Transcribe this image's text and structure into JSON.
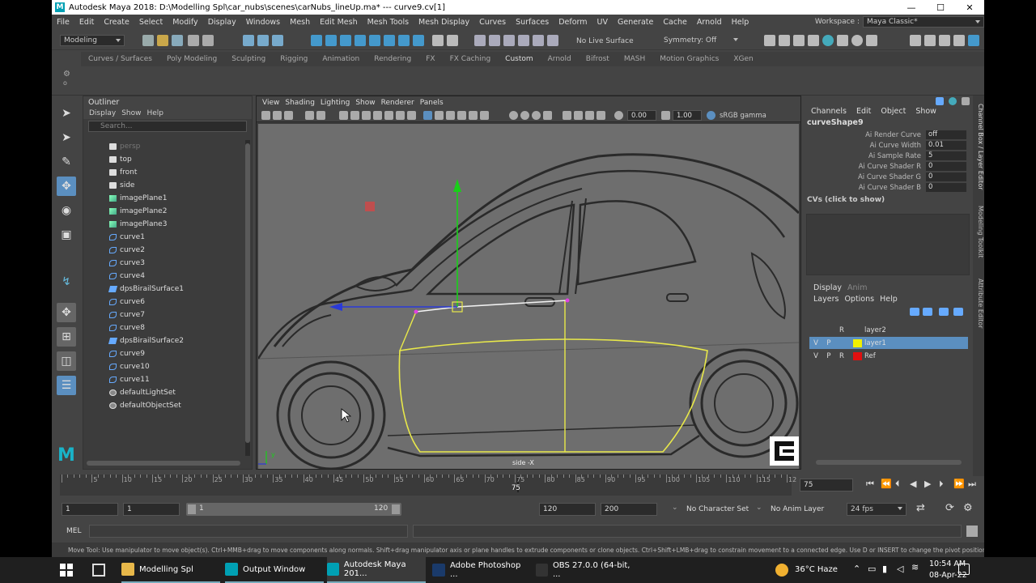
{
  "window": {
    "title": "Autodesk Maya 2018: D:\\Modelling Spl\\car_nubs\\scenes\\carNubs_lineUp.ma*  ---  curve9.cv[1]",
    "logo_letter": "M",
    "minimize": "—",
    "maximize": "☐",
    "close": "✕"
  },
  "menubar": [
    "File",
    "Edit",
    "Create",
    "Select",
    "Modify",
    "Display",
    "Windows",
    "Mesh",
    "Edit Mesh",
    "Mesh Tools",
    "Mesh Display",
    "Curves",
    "Surfaces",
    "Deform",
    "UV",
    "Generate",
    "Cache",
    "Arnold",
    "Help"
  ],
  "workspace": {
    "label": "Workspace :",
    "value": "Maya Classic*"
  },
  "statusline": {
    "mode": "Modeling",
    "live_surface": "No Live Surface",
    "symmetry": "Symmetry: Off"
  },
  "shelf_tabs": [
    "Curves / Surfaces",
    "Poly Modeling",
    "Sculpting",
    "Rigging",
    "Animation",
    "Rendering",
    "FX",
    "FX Caching",
    "Custom",
    "Arnold",
    "Bifrost",
    "MASH",
    "Motion Graphics",
    "XGen"
  ],
  "shelf_active": "Custom",
  "outliner": {
    "title": "Outliner",
    "menu": [
      "Display",
      "Show",
      "Help"
    ],
    "search_placeholder": "Search...",
    "items": [
      {
        "label": "persp",
        "type": "cam",
        "dim": true
      },
      {
        "label": "top",
        "type": "cam"
      },
      {
        "label": "front",
        "type": "cam"
      },
      {
        "label": "side",
        "type": "cam"
      },
      {
        "label": "imagePlane1",
        "type": "img"
      },
      {
        "label": "imagePlane2",
        "type": "img"
      },
      {
        "label": "imagePlane3",
        "type": "img"
      },
      {
        "label": "curve1",
        "type": "crv"
      },
      {
        "label": "curve2",
        "type": "crv"
      },
      {
        "label": "curve3",
        "type": "crv"
      },
      {
        "label": "curve4",
        "type": "crv"
      },
      {
        "label": "dpsBirailSurface1",
        "type": "srf"
      },
      {
        "label": "curve6",
        "type": "crv"
      },
      {
        "label": "curve7",
        "type": "crv"
      },
      {
        "label": "curve8",
        "type": "crv"
      },
      {
        "label": "dpsBirailSurface2",
        "type": "srf"
      },
      {
        "label": "curve9",
        "type": "crv"
      },
      {
        "label": "curve10",
        "type": "crv"
      },
      {
        "label": "curve11",
        "type": "crv"
      },
      {
        "label": "defaultLightSet",
        "type": "set"
      },
      {
        "label": "defaultObjectSet",
        "type": "set"
      }
    ]
  },
  "viewport": {
    "menu": [
      "View",
      "Shading",
      "Lighting",
      "Show",
      "Renderer",
      "Panels"
    ],
    "exposure": "0.00",
    "gamma": "1.00",
    "colorspace": "sRGB gamma",
    "camera_label": "side -X",
    "axis_y": "y",
    "colors": {
      "curve_yellow": "#e8e84a",
      "manip_green": "#18d018",
      "manip_blue": "#2a3ad8",
      "selection_magenta": "#e040e0",
      "red_marker": "#c84a4a"
    }
  },
  "channel_box": {
    "menu": [
      "Channels",
      "Edit",
      "Object",
      "Show"
    ],
    "object": "curveShape9",
    "attributes": [
      {
        "name": "Ai Render Curve",
        "value": "off"
      },
      {
        "name": "Ai Curve Width",
        "value": "0.01"
      },
      {
        "name": "Ai Sample Rate",
        "value": "5"
      },
      {
        "name": "Ai Curve Shader R",
        "value": "0"
      },
      {
        "name": "Ai Curve Shader G",
        "value": "0"
      },
      {
        "name": "Ai Curve Shader B",
        "value": "0"
      }
    ],
    "cvs_label": "CVs (click to show)"
  },
  "side_tabs": [
    "Channel Box / Layer Editor",
    "Modeling Toolkit",
    "Attribute Editor"
  ],
  "layer_editor": {
    "tabs": [
      "Display",
      "Anim"
    ],
    "menu": [
      "Layers",
      "Options",
      "Help"
    ],
    "layers": [
      {
        "v": "",
        "p": "",
        "r": "R",
        "name": "layer2",
        "color": "#444444",
        "selected": false
      },
      {
        "v": "V",
        "p": "P",
        "r": "",
        "name": "layer1",
        "color": "#f0f000",
        "selected": true
      },
      {
        "v": "V",
        "p": "P",
        "r": "R",
        "name": "Ref",
        "color": "#e01010",
        "selected": false
      }
    ]
  },
  "timeline": {
    "ticks": [
      "5",
      "10",
      "15",
      "20",
      "25",
      "30",
      "35",
      "40",
      "45",
      "50",
      "55",
      "60",
      "65",
      "70",
      "75",
      "80",
      "85",
      "90",
      "95",
      "100",
      "105",
      "110",
      "115",
      "12"
    ],
    "current_frame": "75",
    "current_field": "75"
  },
  "range": {
    "start": "1",
    "start2": "1",
    "slider_start": "1",
    "slider_end": "120",
    "end1": "120",
    "end2": "200",
    "character_set": "No Character Set",
    "anim_layer": "No Anim Layer",
    "fps": "24 fps"
  },
  "command": {
    "label": "MEL"
  },
  "help_line": "Move Tool: Use manipulator to move object(s). Ctrl+MMB+drag to move components along normals. Shift+drag manipulator axis or plane handles to extrude components or clone objects. Ctrl+Shift+LMB+drag to constrain movement to a connected edge. Use D or INSERT to change the pivot position and axis orientation.",
  "taskbar": {
    "items": [
      {
        "label": "Modelling Spl",
        "color": "#e8b84a"
      },
      {
        "label": "Output Window",
        "color": "#00a0b4"
      },
      {
        "label": "Autodesk Maya 201...",
        "color": "#00a0b4"
      },
      {
        "label": "Adobe Photoshop ...",
        "color": "#1a3a6a"
      },
      {
        "label": "OBS 27.0.0 (64-bit, ...",
        "color": "#333333"
      }
    ],
    "weather": "36°C  Haze",
    "time": "10:54 AM",
    "date": "08-Apr-22"
  }
}
